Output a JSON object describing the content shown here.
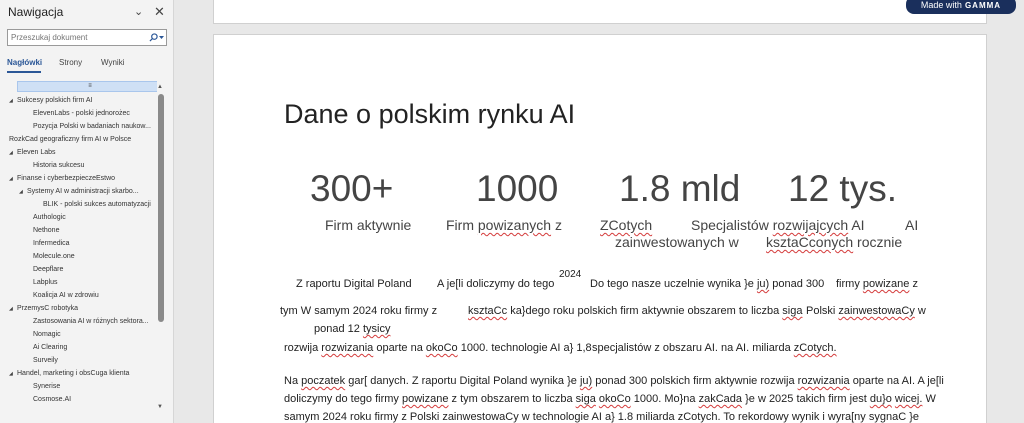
{
  "nav": {
    "title": "Nawigacja",
    "search_placeholder": "Przeszukaj dokument",
    "tabs": [
      "Nagłówki",
      "Strony",
      "Wyniki"
    ],
    "items": [
      "Sukcesy polskich firm AI",
      "ElevenLabs - polski jednorożec",
      "Pozycja Polski w badaniach naukow...",
      "RozkCad geograficzny firm AI w Polsce",
      "Eleven Labs",
      "Historia sukcesu",
      "Finanse i cyberbezpieczeEstwo",
      "Systemy AI w administracji skarbo...",
      "BLIK - polski sukces automatyzacji",
      "Authologic",
      "Nethone",
      "Infermedica",
      "Molecule.one",
      "Deepflare",
      "Labplus",
      "Koalicja AI w zdrowiu",
      "PrzemysC robotyka",
      "Zastosowania AI w różnych sektora...",
      "Nomagic",
      "Ai Clearing",
      "Surveily",
      "Handel, marketing i obsCuga klienta",
      "Synerise",
      "Cosmose.AI"
    ]
  },
  "badge": {
    "prefix": "Made with",
    "brand": "GAMMA"
  },
  "doc": {
    "title": "Dane o polskim rynku AI",
    "stats": [
      "300+",
      "1000",
      "1.8 mld",
      "12 tys."
    ],
    "labels": {
      "firm_aktywnie": "Firm aktywnie",
      "firm": "Firm",
      "powizanych": "powizanych",
      "z": "z",
      "zcotych": "ZCotych",
      "zainwestowanych_w": "zainwestowanych w",
      "specjalistow": "Specjalistów",
      "rozwijajcych": "rozwijajcych",
      "ai1": "AI",
      "ai2": "AI",
      "ksztaCconych": "ksztaCconych",
      "rocznie": "rocznie"
    },
    "para1": {
      "t1": "Z raportu Digital Poland",
      "t2": "A je[li doliczymy do tego",
      "sup": "2024",
      "t3": "Do tego nasze uczelnie wynika }e",
      "ju": "ju)",
      "t3b": "ponad 300",
      "t4": "firmy",
      "powizane": "powizane",
      "t4b": "z",
      "t5": "tym W samym 2024 roku firmy z",
      "ksztaCc": "ksztaCc",
      "t6": "ka}dego roku polskich firm aktywnie   obszarem to liczba",
      "siga": "siga",
      "t7": "Polski",
      "zainwestowaCy": "zainwestowaCy",
      "t7b": "w",
      "t8": "ponad 12",
      "tysicy": "tysicy",
      "t9": "rozwija",
      "rozwizania": "rozwizania",
      "t9b": "oparte na",
      "okoCo": "okoCo",
      "t9c": "1000. technologie AI a} 1,8",
      "t10": "specjalistów z obszaru AI. na AI. miliarda",
      "zCotych": "zCotych."
    },
    "para2": {
      "l1a": "Na",
      "poczatek": "poczatek",
      "l1b": "gar[ danych. Z raportu Digital Poland wynika }e",
      "ju": "ju)",
      "l1c": "ponad 300 polskich firm aktywnie rozwija",
      "rozwizania": "rozwizania",
      "l1d": "oparte na AI. A je[li",
      "l2a": "doliczymy do tego firmy",
      "powizane": "powizane",
      "l2b": "z tym obszarem to liczba",
      "siga": "siga",
      "okoCo": "okoCo",
      "l2c": "1000. Mo}na",
      "zakCada": "zakCada",
      "l2d": "}e w 2025 takich firm jest",
      "duo": "du}o",
      "wicej": "wicej.",
      "l2e": "W",
      "l3": "samym 2024 roku firmy z Polski zainwestowaCy w technologie AI a} 1.8 miliarda zCotych. To rekordowy wynik i wyra[ny sygnaC }e"
    }
  }
}
